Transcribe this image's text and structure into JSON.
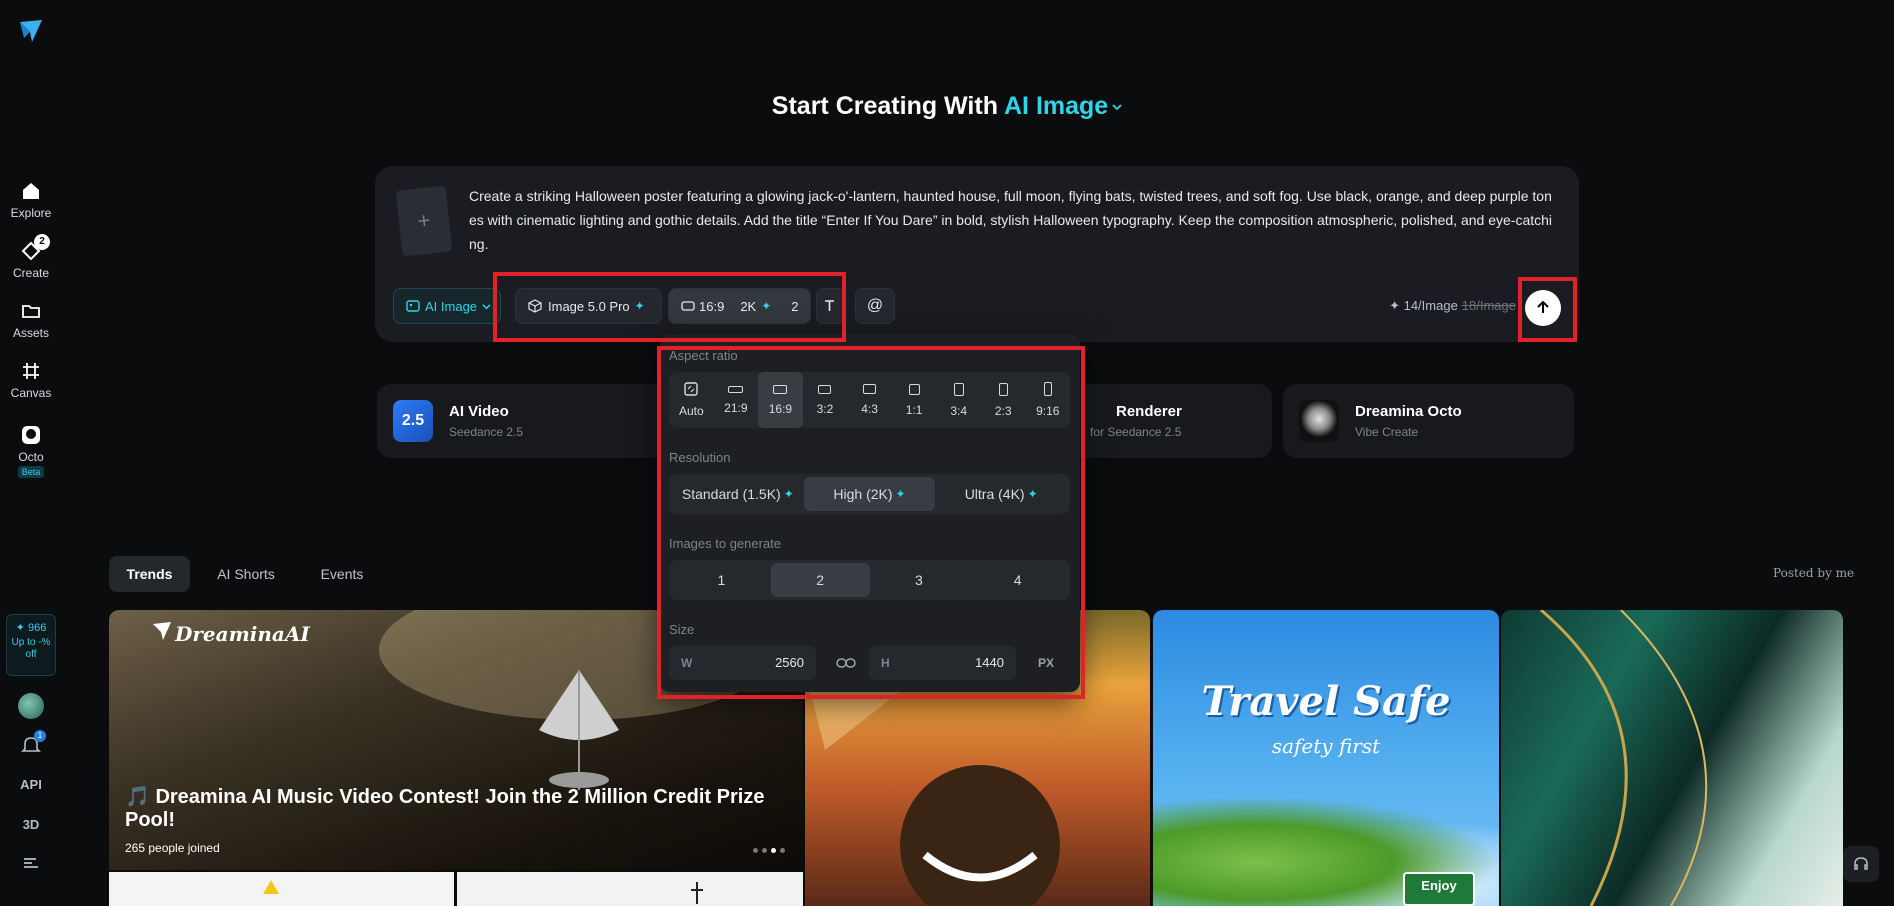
{
  "sidebar": {
    "items": [
      {
        "label": "Explore",
        "icon": "home-icon"
      },
      {
        "label": "Create",
        "icon": "create-icon",
        "badge": "2"
      },
      {
        "label": "Assets",
        "icon": "folder-icon"
      },
      {
        "label": "Canvas",
        "icon": "canvas-icon"
      },
      {
        "label": "Octo",
        "icon": "octo-icon",
        "tag": "Beta"
      }
    ],
    "credits": {
      "amount": "966",
      "promo": "Up to -% off"
    },
    "notification_count": "1",
    "api_label": "API",
    "three_d_label": "3D"
  },
  "header": {
    "title_prefix": "Start Creating With",
    "title_accent": "AI Image"
  },
  "prompt": {
    "text": "Create a striking Halloween poster featuring a glowing jack-o'-lantern, haunted house, full moon, flying bats, twisted trees, and soft fog. Use black, orange, and deep purple tones with cinematic lighting and gothic details. Add the title “Enter If You Dare” in bold, stylish Halloween typography. Keep the composition atmospheric, polished, and eye-catching.",
    "upload_plus": "+",
    "mode_label": "AI Image",
    "model_label": "Image 5.0 Pro",
    "ratio_label": "16:9",
    "resolution_label": "2K",
    "count_label": "2",
    "mention_label": "@",
    "cost_current": "14/Image",
    "cost_original": "18/Image"
  },
  "features": [
    {
      "title": "AI Video",
      "subtitle": "Seedance 2.5",
      "thumb_text": "2.5"
    },
    {
      "title": "Renderer",
      "subtitle": "for Seedance 2.5"
    },
    {
      "title": "Dreamina Octo",
      "subtitle": "Vibe Create"
    }
  ],
  "panel": {
    "aspect_title": "Aspect ratio",
    "ratios": [
      "Auto",
      "21:9",
      "16:9",
      "3:2",
      "4:3",
      "1:1",
      "3:4",
      "2:3",
      "9:16"
    ],
    "selected_ratio": "16:9",
    "resolution_title": "Resolution",
    "resolutions": [
      "Standard (1.5K)",
      "High (2K)",
      "Ultra (4K)"
    ],
    "selected_resolution": "High (2K)",
    "images_title": "Images to generate",
    "counts": [
      "1",
      "2",
      "3",
      "4"
    ],
    "selected_count": "2",
    "size_title": "Size",
    "width_label": "W",
    "width_value": "2560",
    "height_label": "H",
    "height_value": "1440",
    "unit": "PX"
  },
  "tabs": [
    "Trends",
    "AI Shorts",
    "Events"
  ],
  "posted_by": "Posted by me",
  "gallery": {
    "hero_brand": "DreaminaAI",
    "hero_title": "🎵 Dreamina AI Music Video Contest! Join the 2 Million Credit Prize Pool!",
    "hero_joined": "265  people joined",
    "travel_title": "Travel Safe",
    "travel_sub": "safety first",
    "travel_sign": "Enjoy"
  },
  "colors": {
    "accent": "#2fd4e8",
    "highlight": "#e0232a",
    "background": "#0b0c0e"
  }
}
